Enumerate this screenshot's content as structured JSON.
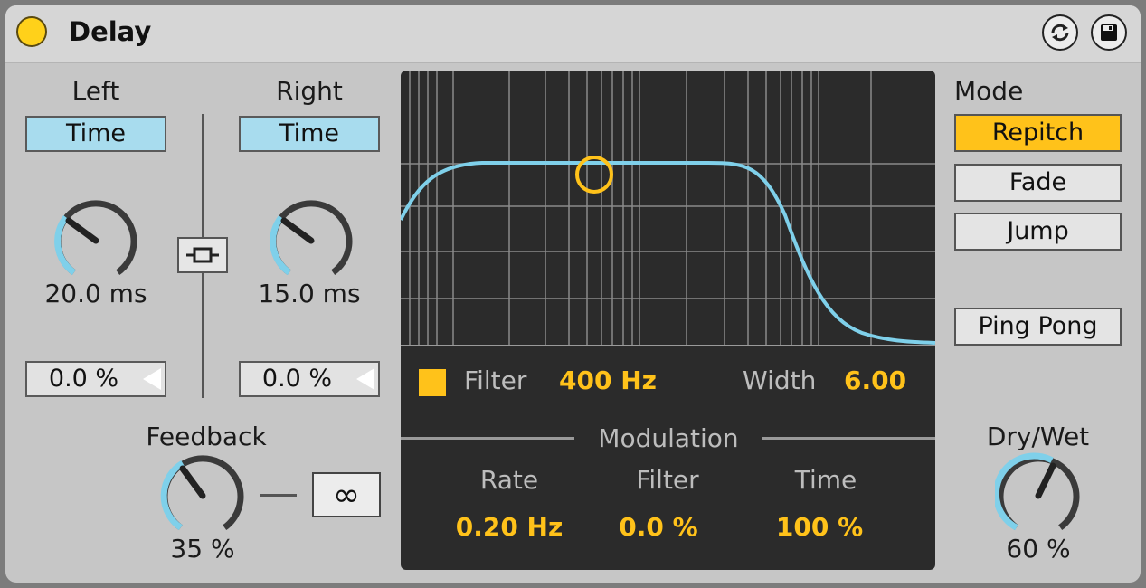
{
  "header": {
    "title": "Delay",
    "power_color": "#ffd11a",
    "icons": [
      "power-icon",
      "hot-swap-icon",
      "save-preset-icon"
    ]
  },
  "left": {
    "label": "Left",
    "sync_button": "Time",
    "knob_value": "20.0 ms",
    "offset_value": "0.0 %"
  },
  "right": {
    "label": "Right",
    "sync_button": "Time",
    "knob_value": "15.0 ms",
    "offset_value": "0.0 %"
  },
  "link_icon": "link-icon",
  "feedback": {
    "label": "Feedback",
    "value": "35 %",
    "freeze_icon": "infinity-icon",
    "freeze_label": "∞"
  },
  "filter_panel": {
    "filter_label": "Filter",
    "filter_value": "400 Hz",
    "width_label": "Width",
    "width_value": "6.00",
    "modulation_title": "Modulation",
    "rate_label": "Rate",
    "rate_value": "0.20 Hz",
    "mod_filter_label": "Filter",
    "mod_filter_value": "0.0 %",
    "mod_time_label": "Time",
    "mod_time_value": "100 %"
  },
  "mode": {
    "label": "Mode",
    "options": [
      "Repitch",
      "Fade",
      "Jump"
    ],
    "selected": "Repitch",
    "ping_pong": "Ping Pong"
  },
  "dry_wet": {
    "label": "Dry/Wet",
    "value": "60 %",
    "level": 0.6
  },
  "colors": {
    "accent": "#ffc21a",
    "knob_arc": "#7fd0ea",
    "sync_on": "#a8dcee",
    "curve": "#7fd0ea",
    "panel_bg": "#2b2b2b"
  }
}
